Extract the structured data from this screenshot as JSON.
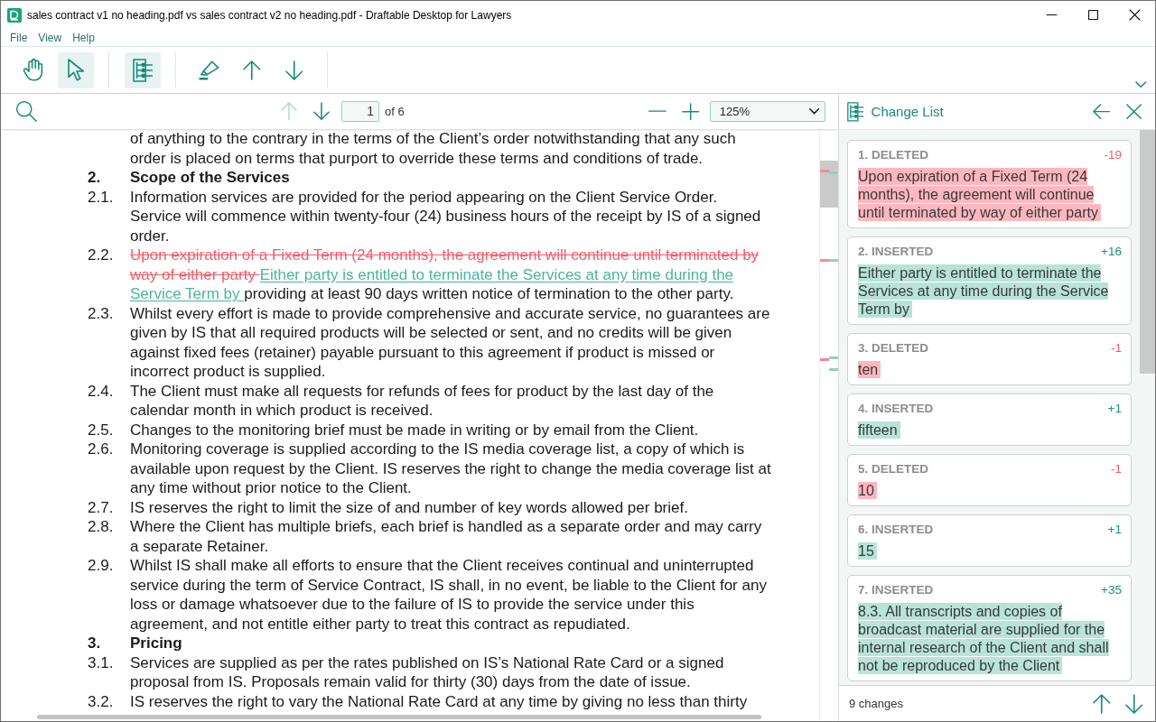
{
  "window": {
    "title": "sales contract v1 no heading.pdf vs sales contract v2 no heading.pdf - Draftable Desktop for Lawyers"
  },
  "menu": [
    {
      "label": "File"
    },
    {
      "label": "View"
    },
    {
      "label": "Help"
    }
  ],
  "toolbar": {
    "groups": [
      [
        {
          "kind": "hand",
          "selected": false
        },
        {
          "kind": "pointer",
          "selected": true
        }
      ],
      [
        {
          "kind": "change-list",
          "selected": true
        }
      ],
      [
        {
          "kind": "marker",
          "selected": false
        },
        {
          "kind": "up",
          "selected": false
        },
        {
          "kind": "down",
          "selected": false
        }
      ]
    ]
  },
  "document_bar": {
    "navigation": [
      {
        "kind": "up",
        "disabled": true
      },
      {
        "kind": "down",
        "disabled": false
      }
    ],
    "page": "1",
    "page_total": "of 6",
    "zoom": "125%"
  },
  "document": {
    "clauses": [
      {
        "kind": "clause",
        "segments": [
          {
            "kind": "plain",
            "text": "of anything to the contrary in the terms of the Client’s order notwithstanding that any such order is placed on terms that purport to override these terms and conditions of trade."
          }
        ]
      },
      {
        "kind": "heading",
        "number": "2.",
        "segments": [
          {
            "kind": "plain",
            "text": "Scope of the Services"
          }
        ]
      },
      {
        "kind": "clause",
        "number": "2.1.",
        "segments": [
          {
            "kind": "plain",
            "text": "Information services are provided for the period appearing on the Client Service Order. Service will commence within twenty-four (24) business hours of the receipt by IS of a signed order."
          }
        ]
      },
      {
        "kind": "clause",
        "number": "2.2.",
        "segments": [
          {
            "kind": "deleted",
            "text": "Upon expiration of a Fixed Term (24 months), the agreement will continue until terminated by way of either party "
          },
          {
            "kind": "inserted",
            "text": "Either party is entitled to terminate the Services at any time during the Service Term by "
          },
          {
            "kind": "plain",
            "text": "providing at least 90 days written notice of termination to the other party."
          }
        ]
      },
      {
        "kind": "clause",
        "number": "2.3.",
        "segments": [
          {
            "kind": "plain",
            "text": "Whilst every effort is made to provide comprehensive and accurate service, no guarantees are given by IS that all required products will be selected or sent, and no credits will be given against fixed fees (retainer) payable pursuant to this agreement if product is missed or incorrect product is supplied."
          }
        ]
      },
      {
        "kind": "clause",
        "number": "2.4.",
        "segments": [
          {
            "kind": "plain",
            "text": "The Client must make all requests for refunds of fees for product by the last day of the calendar month in which product is received."
          }
        ]
      },
      {
        "kind": "clause",
        "number": "2.5.",
        "segments": [
          {
            "kind": "plain",
            "text": "Changes to the monitoring brief must be made in writing or by email from the Client."
          }
        ]
      },
      {
        "kind": "clause",
        "number": "2.6.",
        "segments": [
          {
            "kind": "plain",
            "text": "Monitoring coverage is supplied according to the IS media coverage list, a copy of which is available upon request by the Client. IS reserves the right to change the media coverage list at any time without prior notice to the Client."
          }
        ]
      },
      {
        "kind": "clause",
        "number": "2.7.",
        "segments": [
          {
            "kind": "plain",
            "text": "IS reserves the right to limit the size of and number of key words allowed per brief."
          }
        ]
      },
      {
        "kind": "clause",
        "number": "2.8.",
        "segments": [
          {
            "kind": "plain",
            "text": "Where the Client has multiple briefs, each brief is handled as a separate order and may carry a separate Retainer."
          }
        ]
      },
      {
        "kind": "clause",
        "number": "2.9.",
        "segments": [
          {
            "kind": "plain",
            "text": "Whilst IS shall make all efforts to ensure that the Client receives continual and uninterrupted service during the term of Service Contract, IS shall, in no event, be liable to the Client for any loss or damage whatsoever due to the failure of IS to provide the service under this agreement, and not entitle either party to treat this contract as repudiated."
          }
        ]
      },
      {
        "kind": "heading",
        "number": "3.",
        "segments": [
          {
            "kind": "plain",
            "text": "Pricing"
          }
        ]
      },
      {
        "kind": "clause",
        "number": "3.1.",
        "segments": [
          {
            "kind": "plain",
            "text": "Services are supplied as per the rates published on IS’s National Rate Card or a signed proposal from IS. Proposals remain valid for thirty (30) days from the date of issue."
          }
        ]
      },
      {
        "kind": "clause",
        "number": "3.2.",
        "segments": [
          {
            "kind": "plain",
            "text": "IS reserves the right to vary the National Rate Card at any time by giving no less than thirty"
          }
        ]
      }
    ]
  },
  "change_panel": {
    "title": "Change List",
    "changes": [
      {
        "label": "1. DELETED",
        "kind": "deleted",
        "count": "-19",
        "text": "Upon expiration of a Fixed Term (24 months), the agreement will continue until terminated by way of either party"
      },
      {
        "label": "2. INSERTED",
        "kind": "inserted",
        "count": "+16",
        "text": "Either party is entitled to terminate the Services at any time during the Service Term by"
      },
      {
        "label": "3. DELETED",
        "kind": "deleted",
        "count": "-1",
        "text": "ten"
      },
      {
        "label": "4. INSERTED",
        "kind": "inserted",
        "count": "+1",
        "text": "fifteen"
      },
      {
        "label": "5. DELETED",
        "kind": "deleted",
        "count": "-1",
        "text": "10"
      },
      {
        "label": "6. INSERTED",
        "kind": "inserted",
        "count": "+1",
        "text": "15"
      },
      {
        "label": "7. INSERTED",
        "kind": "inserted",
        "count": "+35",
        "text": "8.3. All transcripts and copies of broadcast material are supplied for the internal research of the Client and shall not be reproduced by the Client"
      }
    ],
    "summary": "9 changes"
  }
}
